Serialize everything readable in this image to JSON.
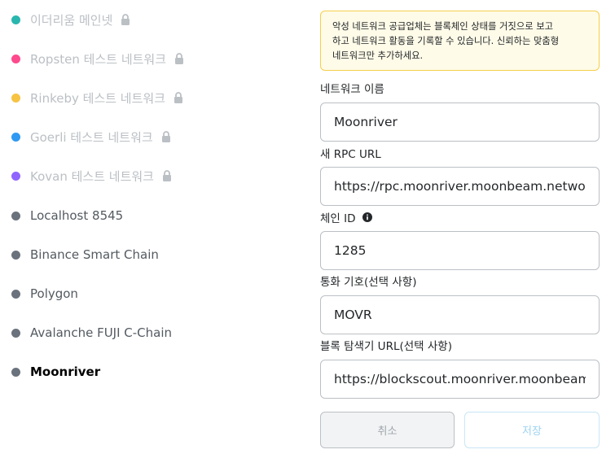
{
  "networks": [
    {
      "label": "이더리움 메인넷",
      "color": "#29b6af",
      "locked": true,
      "style": "muted"
    },
    {
      "label": "Ropsten 테스트 네트워크",
      "color": "#ff4a8d",
      "locked": true,
      "style": "muted"
    },
    {
      "label": "Rinkeby 테스트 네트워크",
      "color": "#f6c343",
      "locked": true,
      "style": "muted"
    },
    {
      "label": "Goerli 테스트 네트워크",
      "color": "#3099f2",
      "locked": true,
      "style": "muted"
    },
    {
      "label": "Kovan 테스트 네트워크",
      "color": "#9064ff",
      "locked": true,
      "style": "muted"
    },
    {
      "label": "Localhost 8545",
      "color": "#6a737d",
      "locked": false,
      "style": "normal"
    },
    {
      "label": "Binance Smart Chain",
      "color": "#6a737d",
      "locked": false,
      "style": "normal"
    },
    {
      "label": "Polygon",
      "color": "#6a737d",
      "locked": false,
      "style": "normal"
    },
    {
      "label": "Avalanche FUJI C-Chain",
      "color": "#6a737d",
      "locked": false,
      "style": "normal"
    },
    {
      "label": "Moonriver",
      "color": "#6a737d",
      "locked": false,
      "style": "selected"
    }
  ],
  "warning": {
    "line1": "악성 네트워크 공급업체는 블록체인 상태를 거짓으로 보고",
    "line2": "하고 네트워크 활동을 기록할 수 있습니다. 신뢰하는 맞춤형",
    "line3": "네트워크만 추가하세요."
  },
  "fields": {
    "network_name": {
      "label": "네트워크 이름",
      "value": "Moonriver"
    },
    "rpc_url": {
      "label": "새 RPC URL",
      "value": "https://rpc.moonriver.moonbeam.network"
    },
    "chain_id": {
      "label": "체인 ID",
      "value": "1285"
    },
    "currency_symbol": {
      "label": "통화 기호(선택 사항)",
      "value": "MOVR"
    },
    "block_explorer": {
      "label": "블록 탐색기 URL(선택 사항)",
      "value": "https://blockscout.moonriver.moonbeam.network"
    }
  },
  "buttons": {
    "cancel": "취소",
    "save": "저장"
  },
  "icons": {
    "lock": "lock-icon",
    "info": "info-icon"
  },
  "colors": {
    "warning_bg": "#fefbe8",
    "warning_border": "#f5cf4d",
    "input_border": "#bbc0c5",
    "save_text": "#9fd3f1"
  }
}
